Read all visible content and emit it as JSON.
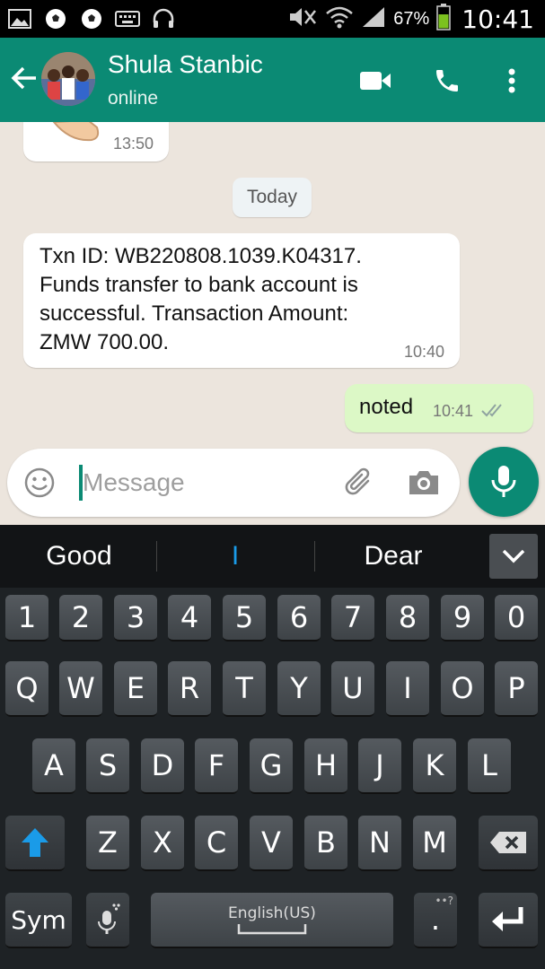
{
  "status_bar": {
    "battery_pct": "67%",
    "time": "10:41"
  },
  "header": {
    "contact_name": "Shula Stanbic",
    "status": "online"
  },
  "chat": {
    "earlier_time": "13:50",
    "day_label": "Today",
    "incoming": {
      "lines": [
        "Txn ID: WB220808.1039.K04317.",
        "Funds transfer to bank account is",
        "successful. Transaction Amount:",
        "ZMW 700.00."
      ],
      "time": "10:40"
    },
    "outgoing": {
      "text": "noted",
      "time": "10:41"
    }
  },
  "composer": {
    "placeholder": "Message"
  },
  "keyboard": {
    "suggestions": [
      "Good",
      "I",
      "Dear"
    ],
    "row_numbers": [
      "1",
      "2",
      "3",
      "4",
      "5",
      "6",
      "7",
      "8",
      "9",
      "0"
    ],
    "row_1": [
      "Q",
      "W",
      "E",
      "R",
      "T",
      "Y",
      "U",
      "I",
      "O",
      "P"
    ],
    "row_2": [
      "A",
      "S",
      "D",
      "F",
      "G",
      "H",
      "J",
      "K",
      "L"
    ],
    "row_3": [
      "Z",
      "X",
      "C",
      "V",
      "B",
      "N",
      "M"
    ],
    "sym_label": "Sym",
    "language_label": "English(US)",
    "period_key": "."
  },
  "colors": {
    "header": "#0b8a74",
    "outgoing_bubble": "#dcf8c6",
    "keyboard": "#1e2225",
    "accent_blue": "#1a9be8"
  }
}
